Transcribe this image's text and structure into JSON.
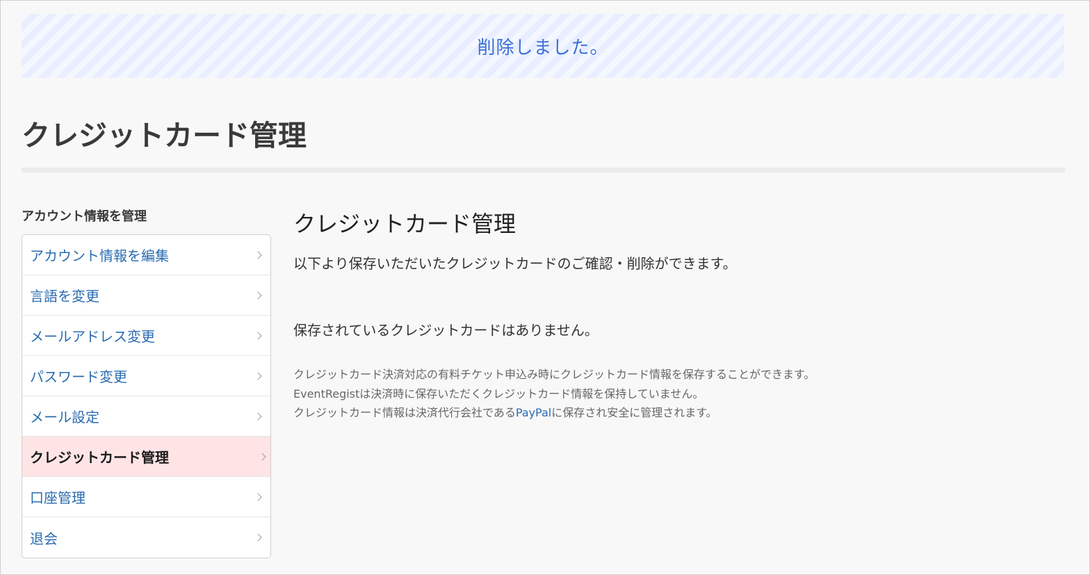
{
  "flash": {
    "message": "削除しました。"
  },
  "page": {
    "title": "クレジットカード管理"
  },
  "sidebar": {
    "heading": "アカウント情報を管理",
    "items": [
      {
        "label": "アカウント情報を編集",
        "active": false
      },
      {
        "label": "言語を変更",
        "active": false
      },
      {
        "label": "メールアドレス変更",
        "active": false
      },
      {
        "label": "パスワード変更",
        "active": false
      },
      {
        "label": "メール設定",
        "active": false
      },
      {
        "label": "クレジットカード管理",
        "active": true
      },
      {
        "label": "口座管理",
        "active": false
      },
      {
        "label": "退会",
        "active": false
      }
    ]
  },
  "main": {
    "title": "クレジットカード管理",
    "description": "以下より保存いただいたクレジットカードのご確認・削除ができます。",
    "empty_message": "保存されているクレジットカードはありません。",
    "notes": {
      "line1": "クレジットカード決済対応の有料チケット申込み時にクレジットカード情報を保存することができます。",
      "line2": "EventRegistは決済時に保存いただくクレジットカード情報を保持していません。",
      "line3_before": "クレジットカード情報は決済代行会社である",
      "line3_link": "PayPal",
      "line3_after": "に保存され安全に管理されます。"
    }
  },
  "colors": {
    "flash_text": "#3b6fd8",
    "flash_bg": "#e8eeff",
    "link": "#2b6cb0",
    "active_bg": "#ffe4e6"
  }
}
